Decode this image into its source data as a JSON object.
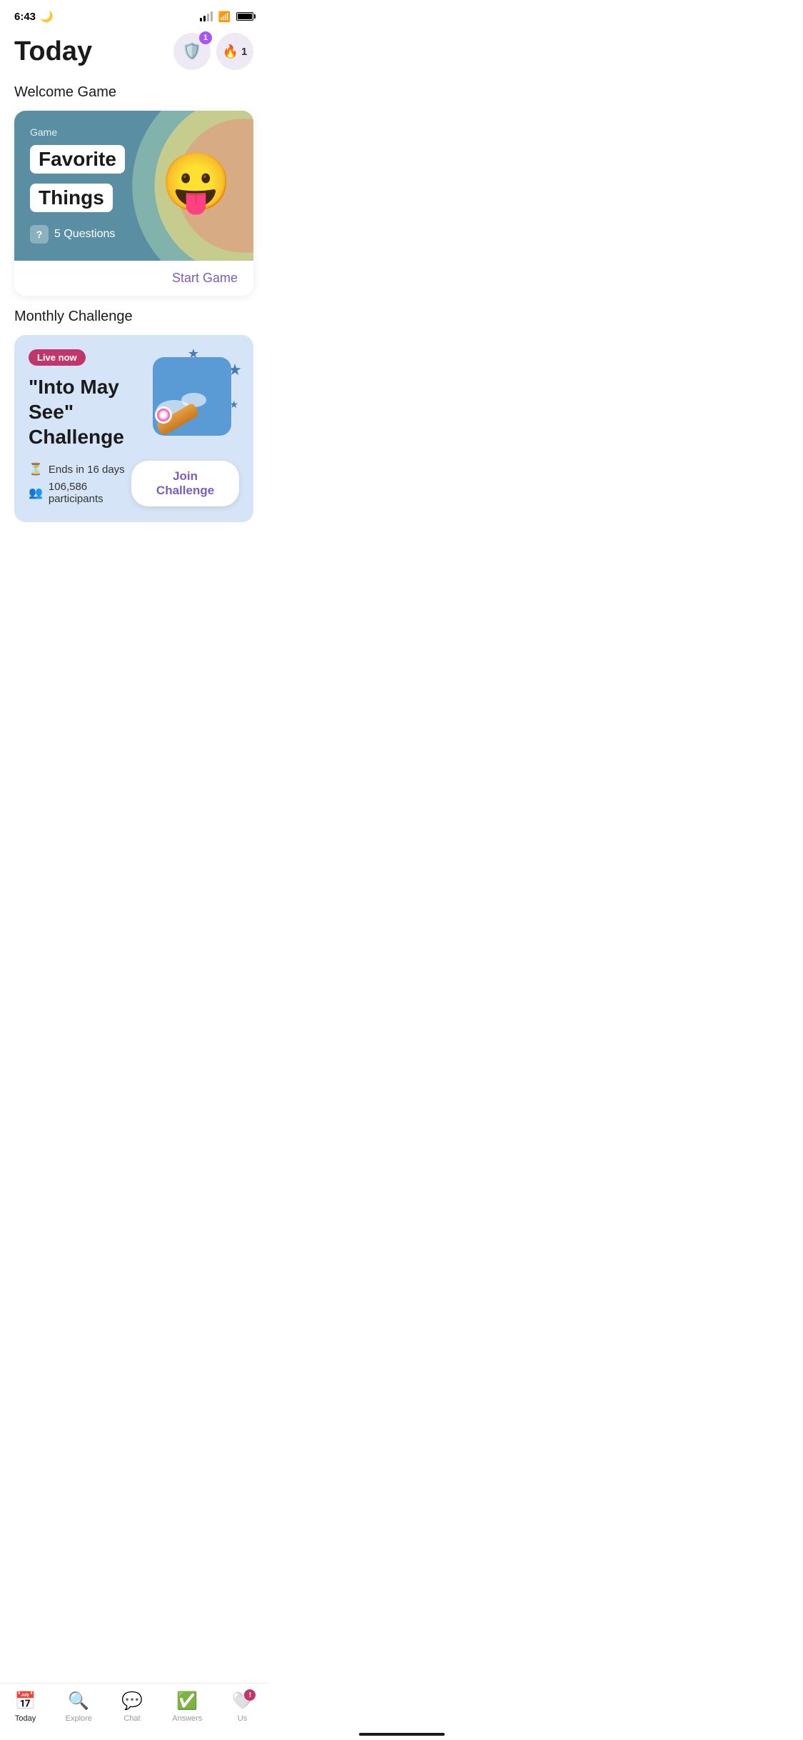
{
  "statusBar": {
    "time": "6:43",
    "moonIcon": "🌙"
  },
  "header": {
    "title": "Today",
    "badgeCount": "1",
    "flameCount": "1"
  },
  "welcomeGame": {
    "sectionTitle": "Welcome Game",
    "cardLabel": "Game",
    "titleLine1": "Favorite",
    "titleLine2": "Things",
    "questionsIcon": "?",
    "questionsText": "5 Questions",
    "emoji": "😛",
    "startGameLabel": "Start Game"
  },
  "monthlyChallenge": {
    "sectionTitle": "Monthly Challenge",
    "liveBadge": "Live now",
    "challengeTitle": "\"Into May See\" Challenge",
    "endsText": "Ends in 16 days",
    "participantsText": "106,586 participants",
    "joinLabel": "Join Challenge"
  },
  "bottomNav": {
    "items": [
      {
        "label": "Today",
        "icon": "📅",
        "active": true
      },
      {
        "label": "Explore",
        "icon": "🔍",
        "active": false
      },
      {
        "label": "Chat",
        "icon": "💬",
        "active": false
      },
      {
        "label": "Answers",
        "icon": "✅",
        "active": false
      },
      {
        "label": "Us",
        "icon": "❤️",
        "active": false,
        "badge": "!"
      }
    ]
  }
}
